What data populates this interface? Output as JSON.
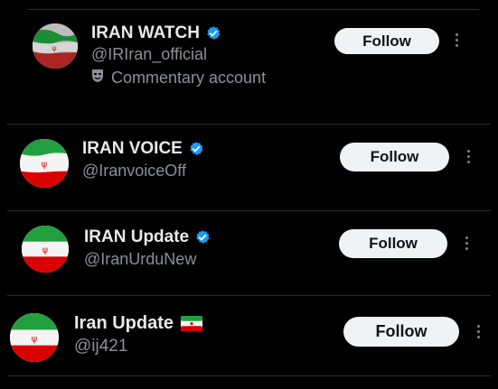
{
  "accounts": [
    {
      "name": "IRAN WATCH",
      "handle": "@IRIran_official",
      "label": "Commentary account",
      "verified": true,
      "follow_label": "Follow"
    },
    {
      "name": "IRAN VOICE",
      "handle": "@IranvoiceOff",
      "verified": true,
      "follow_label": "Follow"
    },
    {
      "name": "IRAN Update",
      "handle": "@IranUrduNew",
      "verified": true,
      "follow_label": "Follow"
    },
    {
      "name": "Iran Update",
      "handle": "@ij421",
      "verified": false,
      "name_flag_icon": "iran-flag-emoji",
      "follow_label": "Follow"
    }
  ],
  "colors": {
    "background": "#000000",
    "verified_badge": "#1d9bf0",
    "follow_button_bg": "#eff3f4",
    "follow_button_text": "#0f1419",
    "secondary_text": "#8b9096",
    "flag_green": "#239f40",
    "flag_red": "#da0000"
  },
  "icons": {
    "avatar": "iran-flag-avatar",
    "verified": "verified-badge-icon",
    "label": "mask-icon",
    "more": "more-options-icon"
  }
}
